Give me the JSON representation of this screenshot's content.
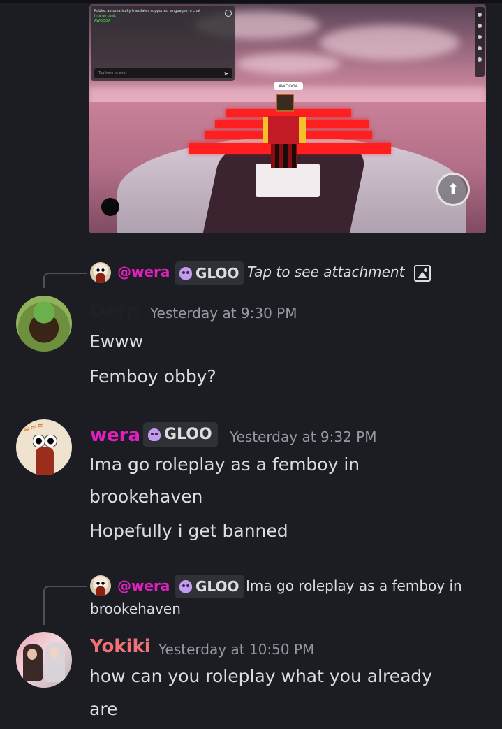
{
  "attachment": {
    "chat_notice": "Roblox automatically translates supported languages in chat",
    "chat_line_1": "Ima go peak",
    "chat_line_2": "AWOOGA",
    "chat_input_placeholder": "Tap here to chat",
    "nametag": "AWOOGA"
  },
  "messages": [
    {
      "reply": {
        "mention": "@wera",
        "tag": "GLOO",
        "preview": "Tap to see attachment",
        "preview_icon": "image-icon"
      },
      "author": "Derp",
      "author_color": "#1f2023",
      "timestamp": "Yesterday at 9:30 PM",
      "lines": [
        "Ewww",
        "Femboy obby?"
      ]
    },
    {
      "author": "wera",
      "author_color": "#e01fbf",
      "tag": "GLOO",
      "timestamp": "Yesterday at 9:32 PM",
      "lines": [
        "Ima go roleplay as a femboy in",
        "brookehaven",
        "Hopefully i get banned"
      ]
    },
    {
      "reply": {
        "mention": "@wera",
        "tag": "GLOO",
        "preview_line_1": "Ima go roleplay as a femboy in",
        "preview_line_2": "brookehaven"
      },
      "author": "Yokiki",
      "author_color": "#f07178",
      "timestamp": "Yesterday at 10:50 PM",
      "lines": [
        "how can you roleplay what you already",
        "are"
      ]
    }
  ],
  "colors": {
    "background": "#1c1d22",
    "text": "#dbdee1",
    "muted": "#949ba4",
    "mention": "#e01fbf"
  }
}
